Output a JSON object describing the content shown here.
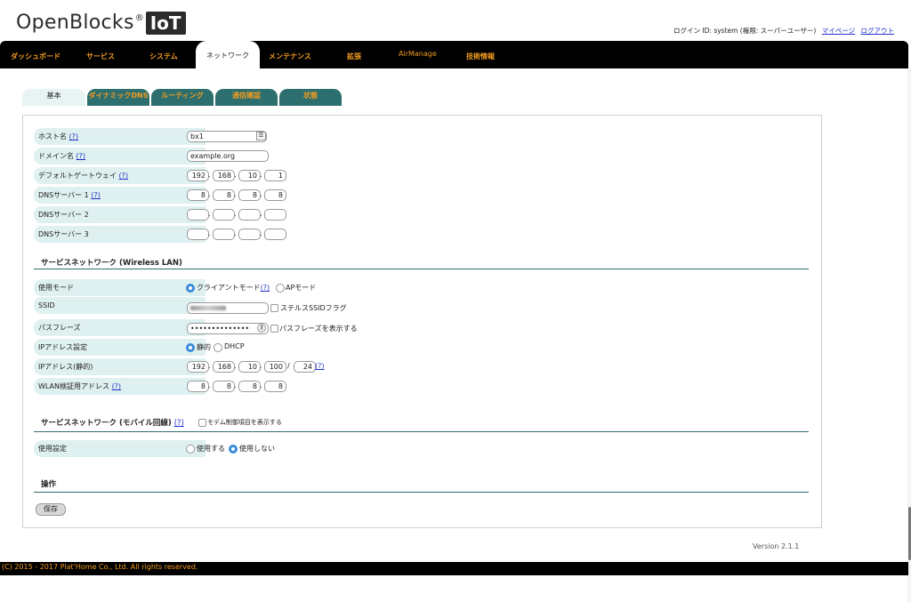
{
  "header": {
    "logo_name": "OpenBlocks",
    "logo_reg": "®",
    "logo_iot": "IoT",
    "login_text": "ログイン ID: system (権限: スーパーユーザー)",
    "mypage": "マイページ",
    "logout": "ログアウト"
  },
  "nav": [
    "ダッシュボード",
    "サービス",
    "システム",
    "ネットワーク",
    "メンテナンス",
    "拡張",
    "AirManage",
    "技術情報"
  ],
  "subtabs": [
    "基本",
    "ダイナミックDNS",
    "ルーティング",
    "通信確認",
    "状態"
  ],
  "form": {
    "hostname_label": "ホスト名",
    "help": "(?)",
    "hostname_value": "bx1",
    "domain_label": "ドメイン名",
    "domain_value": "example.org",
    "gateway_label": "デフォルトゲートウェイ",
    "gateway": [
      "192",
      "168",
      "10",
      "1"
    ],
    "dns1_label": "DNSサーバー 1",
    "dns1": [
      "8",
      "8",
      "8",
      "8"
    ],
    "dns2_label": "DNSサーバー 2",
    "dns3_label": "DNSサーバー 3",
    "dot": ".",
    "slash": "/"
  },
  "wlan": {
    "section_title": "サービスネットワーク (Wireless LAN)",
    "mode_label": "使用モード",
    "client_mode": "クライアントモード",
    "ap_mode": "APモード",
    "ssid_label": "SSID",
    "stealth_label": "ステルスSSIDフラグ",
    "pass_label": "パスフレーズ",
    "pass_value": "••••••••••••••",
    "show_pass_label": "パスフレーズを表示する",
    "ip_setting_label": "IPアドレス設定",
    "static": "静的",
    "dhcp": "DHCP",
    "ip_static_label": "IPアドレス(静的)",
    "ip": [
      "192",
      "168",
      "10",
      "100"
    ],
    "prefix": "24",
    "check_label": "WLAN検証用アドレス",
    "check": [
      "8",
      "8",
      "8",
      "8"
    ]
  },
  "mobile": {
    "section_title": "サービスネットワーク (モバイル回線)",
    "modem_label": "モデム制御項目を表示する",
    "use_label": "使用設定",
    "use": "使用する",
    "not_use": "使用しない"
  },
  "ops": {
    "title": "操作",
    "save": "保存"
  },
  "version": "Version 2.1.1",
  "footer": "(C) 2015 - 2017 Plat'Home Co., Ltd. All rights reserved."
}
